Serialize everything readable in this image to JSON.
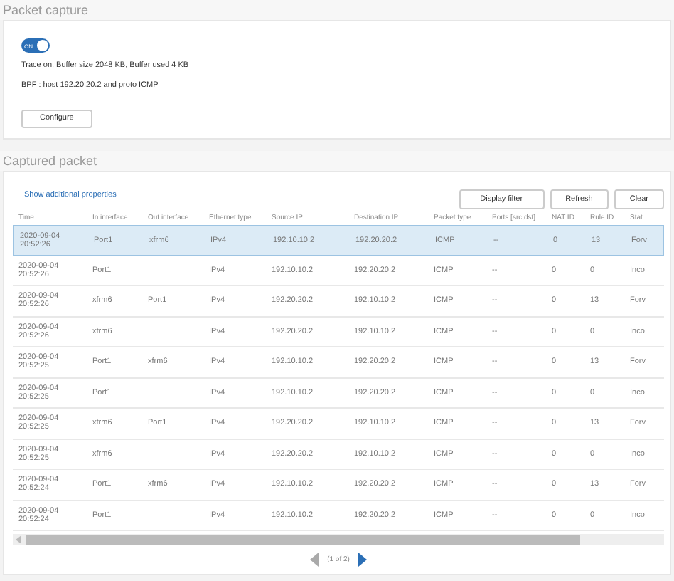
{
  "capture": {
    "title": "Packet capture",
    "toggle": {
      "label": "ON",
      "on": true
    },
    "status": "Trace on, Buffer size 2048 KB, Buffer used 4 KB",
    "bpf": "BPF : host 192.20.20.2 and proto ICMP",
    "configure_button": "Configure"
  },
  "captured": {
    "title": "Captured packet",
    "link": "Show additional properties",
    "buttons": [
      "Display filter",
      "Refresh",
      "Clear"
    ],
    "columns": [
      "Time",
      "In interface",
      "Out interface",
      "Ethernet type",
      "Source IP",
      "Destination IP",
      "Packet type",
      "Ports [src,dst]",
      "NAT ID",
      "Rule ID",
      "Stat"
    ],
    "rows": [
      {
        "selected": true,
        "cells": [
          "2020-09-04\n20:52:26",
          "Port1",
          "xfrm6",
          "IPv4",
          "192.10.10.2",
          "192.20.20.2",
          "ICMP",
          "--",
          "0",
          "13",
          "Forv"
        ]
      },
      {
        "selected": false,
        "cells": [
          "2020-09-04\n20:52:26",
          "Port1",
          null,
          "IPv4",
          "192.10.10.2",
          "192.20.20.2",
          "ICMP",
          "--",
          "0",
          "0",
          "Inco"
        ]
      },
      {
        "selected": false,
        "cells": [
          "2020-09-04\n20:52:26",
          "xfrm6",
          "Port1",
          "IPv4",
          "192.20.20.2",
          "192.10.10.2",
          "ICMP",
          "--",
          "0",
          "13",
          "Forv"
        ]
      },
      {
        "selected": false,
        "cells": [
          "2020-09-04\n20:52:26",
          "xfrm6",
          null,
          "IPv4",
          "192.20.20.2",
          "192.10.10.2",
          "ICMP",
          "--",
          "0",
          "0",
          "Inco"
        ]
      },
      {
        "selected": false,
        "cells": [
          "2020-09-04\n20:52:25",
          "Port1",
          "xfrm6",
          "IPv4",
          "192.10.10.2",
          "192.20.20.2",
          "ICMP",
          "--",
          "0",
          "13",
          "Forv"
        ]
      },
      {
        "selected": false,
        "cells": [
          "2020-09-04\n20:52:25",
          "Port1",
          null,
          "IPv4",
          "192.10.10.2",
          "192.20.20.2",
          "ICMP",
          "--",
          "0",
          "0",
          "Inco"
        ]
      },
      {
        "selected": false,
        "cells": [
          "2020-09-04\n20:52:25",
          "xfrm6",
          "Port1",
          "IPv4",
          "192.20.20.2",
          "192.10.10.2",
          "ICMP",
          "--",
          "0",
          "13",
          "Forv"
        ]
      },
      {
        "selected": false,
        "cells": [
          "2020-09-04\n20:52:25",
          "xfrm6",
          null,
          "IPv4",
          "192.20.20.2",
          "192.10.10.2",
          "ICMP",
          "--",
          "0",
          "0",
          "Inco"
        ]
      },
      {
        "selected": false,
        "cells": [
          "2020-09-04\n20:52:24",
          "Port1",
          "xfrm6",
          "IPv4",
          "192.10.10.2",
          "192.20.20.2",
          "ICMP",
          "--",
          "0",
          "13",
          "Forv"
        ]
      },
      {
        "selected": false,
        "cells": [
          "2020-09-04\n20:52:24",
          "Port1",
          null,
          "IPv4",
          "192.10.10.2",
          "192.20.20.2",
          "ICMP",
          "--",
          "0",
          "0",
          "Inco"
        ]
      }
    ],
    "pagination": {
      "label": "(1 of 2)",
      "prev_disabled": true,
      "next_disabled": false
    }
  }
}
